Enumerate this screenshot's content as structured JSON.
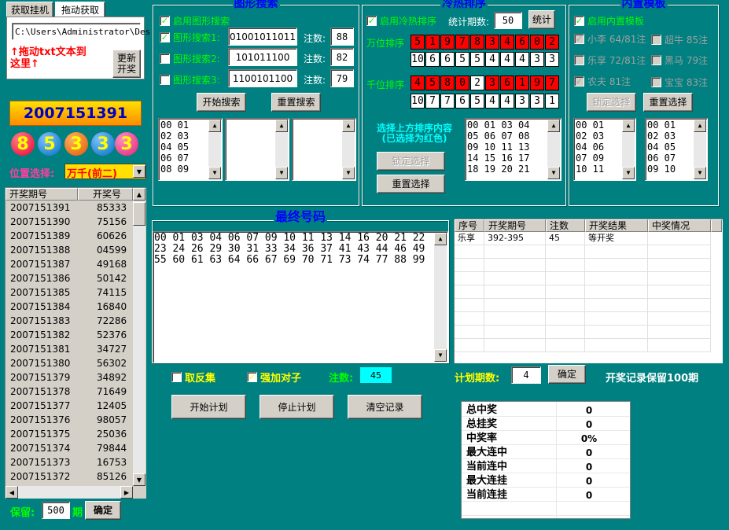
{
  "tabs": {
    "t1": "获取挂机",
    "t2": "拖动获取"
  },
  "file_path": "C:\\Users\\Administrator\\Des",
  "drag_hint": {
    "line1": "↑拖动txt文本到",
    "line2": "这里↑"
  },
  "refresh_label_1": "更新",
  "refresh_label_2": "开奖",
  "current_issue": "2007151391",
  "balls": [
    "8",
    "5",
    "3",
    "3",
    "3"
  ],
  "position": {
    "label": "位置选择:",
    "value": "万千(前二)"
  },
  "history": {
    "col1": "开奖期号",
    "col2": "开奖号",
    "rows": [
      [
        "2007151391",
        "85333"
      ],
      [
        "2007151390",
        "75156"
      ],
      [
        "2007151389",
        "60626"
      ],
      [
        "2007151388",
        "04599"
      ],
      [
        "2007151387",
        "49168"
      ],
      [
        "2007151386",
        "50142"
      ],
      [
        "2007151385",
        "74115"
      ],
      [
        "2007151384",
        "16840"
      ],
      [
        "2007151383",
        "72286"
      ],
      [
        "2007151382",
        "52376"
      ],
      [
        "2007151381",
        "34727"
      ],
      [
        "2007151380",
        "56302"
      ],
      [
        "2007151379",
        "34892"
      ],
      [
        "2007151378",
        "71649"
      ],
      [
        "2007151377",
        "12405"
      ],
      [
        "2007151376",
        "98057"
      ],
      [
        "2007151375",
        "25036"
      ],
      [
        "2007151374",
        "79844"
      ],
      [
        "2007151373",
        "16753"
      ],
      [
        "2007151372",
        "85126"
      ]
    ]
  },
  "keep": {
    "label": "保留:",
    "value": "500",
    "unit": "期",
    "ok": "确定"
  },
  "pattern": {
    "title": "图形搜索",
    "enable": "启用图形搜索",
    "rows": [
      {
        "label": "图形搜索1:",
        "value": "01001011011",
        "count_label": "注数:",
        "count": "88"
      },
      {
        "label": "图形搜索2:",
        "value": "101011100",
        "count_label": "注数:",
        "count": "82"
      },
      {
        "label": "图形搜索3:",
        "value": "1100101100",
        "count_label": "注数:",
        "count": "79"
      }
    ],
    "start": "开始搜索",
    "reset": "重置搜索",
    "list1": [
      "00 01",
      "02 03",
      "04 05",
      "06 07",
      "08 09"
    ]
  },
  "hotcold": {
    "title": "冷热排序",
    "enable": "启用冷热排序",
    "period_label": "统计期数:",
    "period": "50",
    "stat": "统计",
    "wan_label": "万位排序",
    "wan_digits": [
      "5",
      "1",
      "9",
      "7",
      "8",
      "3",
      "4",
      "6",
      "0",
      "2"
    ],
    "wan_counts": [
      "10",
      "6",
      "6",
      "5",
      "5",
      "4",
      "4",
      "4",
      "3",
      "3"
    ],
    "qian_label": "千位排序",
    "qian_digits": [
      "4",
      "5",
      "8",
      "0",
      "2",
      "3",
      "6",
      "1",
      "9",
      "7"
    ],
    "qian_counts": [
      "10",
      "7",
      "7",
      "6",
      "5",
      "4",
      "4",
      "3",
      "3",
      "1"
    ],
    "hint1": "选择上方排序内容",
    "hint2": "(已选择为红色)",
    "lock": "锁定选择",
    "reset": "重置选择",
    "list": [
      "00 01 03 04",
      "05 06 07 08",
      "09 10 11 13",
      "14 15 16 17",
      "18 19 20 21"
    ]
  },
  "builtin": {
    "title": "内置模板",
    "enable": "启用内置模板",
    "items": [
      {
        "label": "小李 64/81注"
      },
      {
        "label": "超牛 85注"
      },
      {
        "label": "乐享 72/81注"
      },
      {
        "label": "黑马 79注"
      },
      {
        "label": "农夫 81注"
      },
      {
        "label": "宝宝 83注"
      }
    ],
    "lock": "锁定选择",
    "reset": "重置选择",
    "list1": [
      "00 01",
      "02 03",
      "04 06",
      "07 09",
      "10 11"
    ],
    "list2": [
      "00 01",
      "02 03",
      "04 05",
      "06 07",
      "09 10"
    ]
  },
  "final": {
    "title": "最终号码",
    "lines": [
      "00 01 03 04 06 07 09 10 11 13 14 16 20 21 22",
      "23 24 26 29 30 31 33 34 36 37 41 43 44 46 49",
      "55 60 61 63 64 66 67 69 70 71 73 74 77 88 99"
    ]
  },
  "plan_table": {
    "headers": [
      "序号",
      "开奖期号",
      "注数",
      "开奖结果",
      "中奖情况"
    ],
    "rows": [
      [
        "乐享",
        "392-395",
        "45",
        "等开奖",
        ""
      ]
    ]
  },
  "options": {
    "invert": "取反集",
    "pair": "强加对子",
    "count_label": "注数:",
    "count": "45"
  },
  "plan": {
    "period_label": "计划期数:",
    "period": "4",
    "ok": "确定",
    "record_note": "开奖记录保留100期"
  },
  "actions": {
    "start": "开始计划",
    "stop": "停止计划",
    "clear": "清空记录"
  },
  "stats": [
    [
      "总中奖",
      "0"
    ],
    [
      "总挂奖",
      "0"
    ],
    [
      "中奖率",
      "0%"
    ],
    [
      "最大连中",
      "0"
    ],
    [
      "当前连中",
      "0"
    ],
    [
      "最大连挂",
      "0"
    ],
    [
      "当前连挂",
      "0"
    ]
  ],
  "colors": {
    "bg": "#008080",
    "red": "#ff0000",
    "ball_red": "#e8003a",
    "ball_blue": "#0070c0",
    "ball_orange": "#e05a00",
    "ball_pink": "#e0207a"
  }
}
